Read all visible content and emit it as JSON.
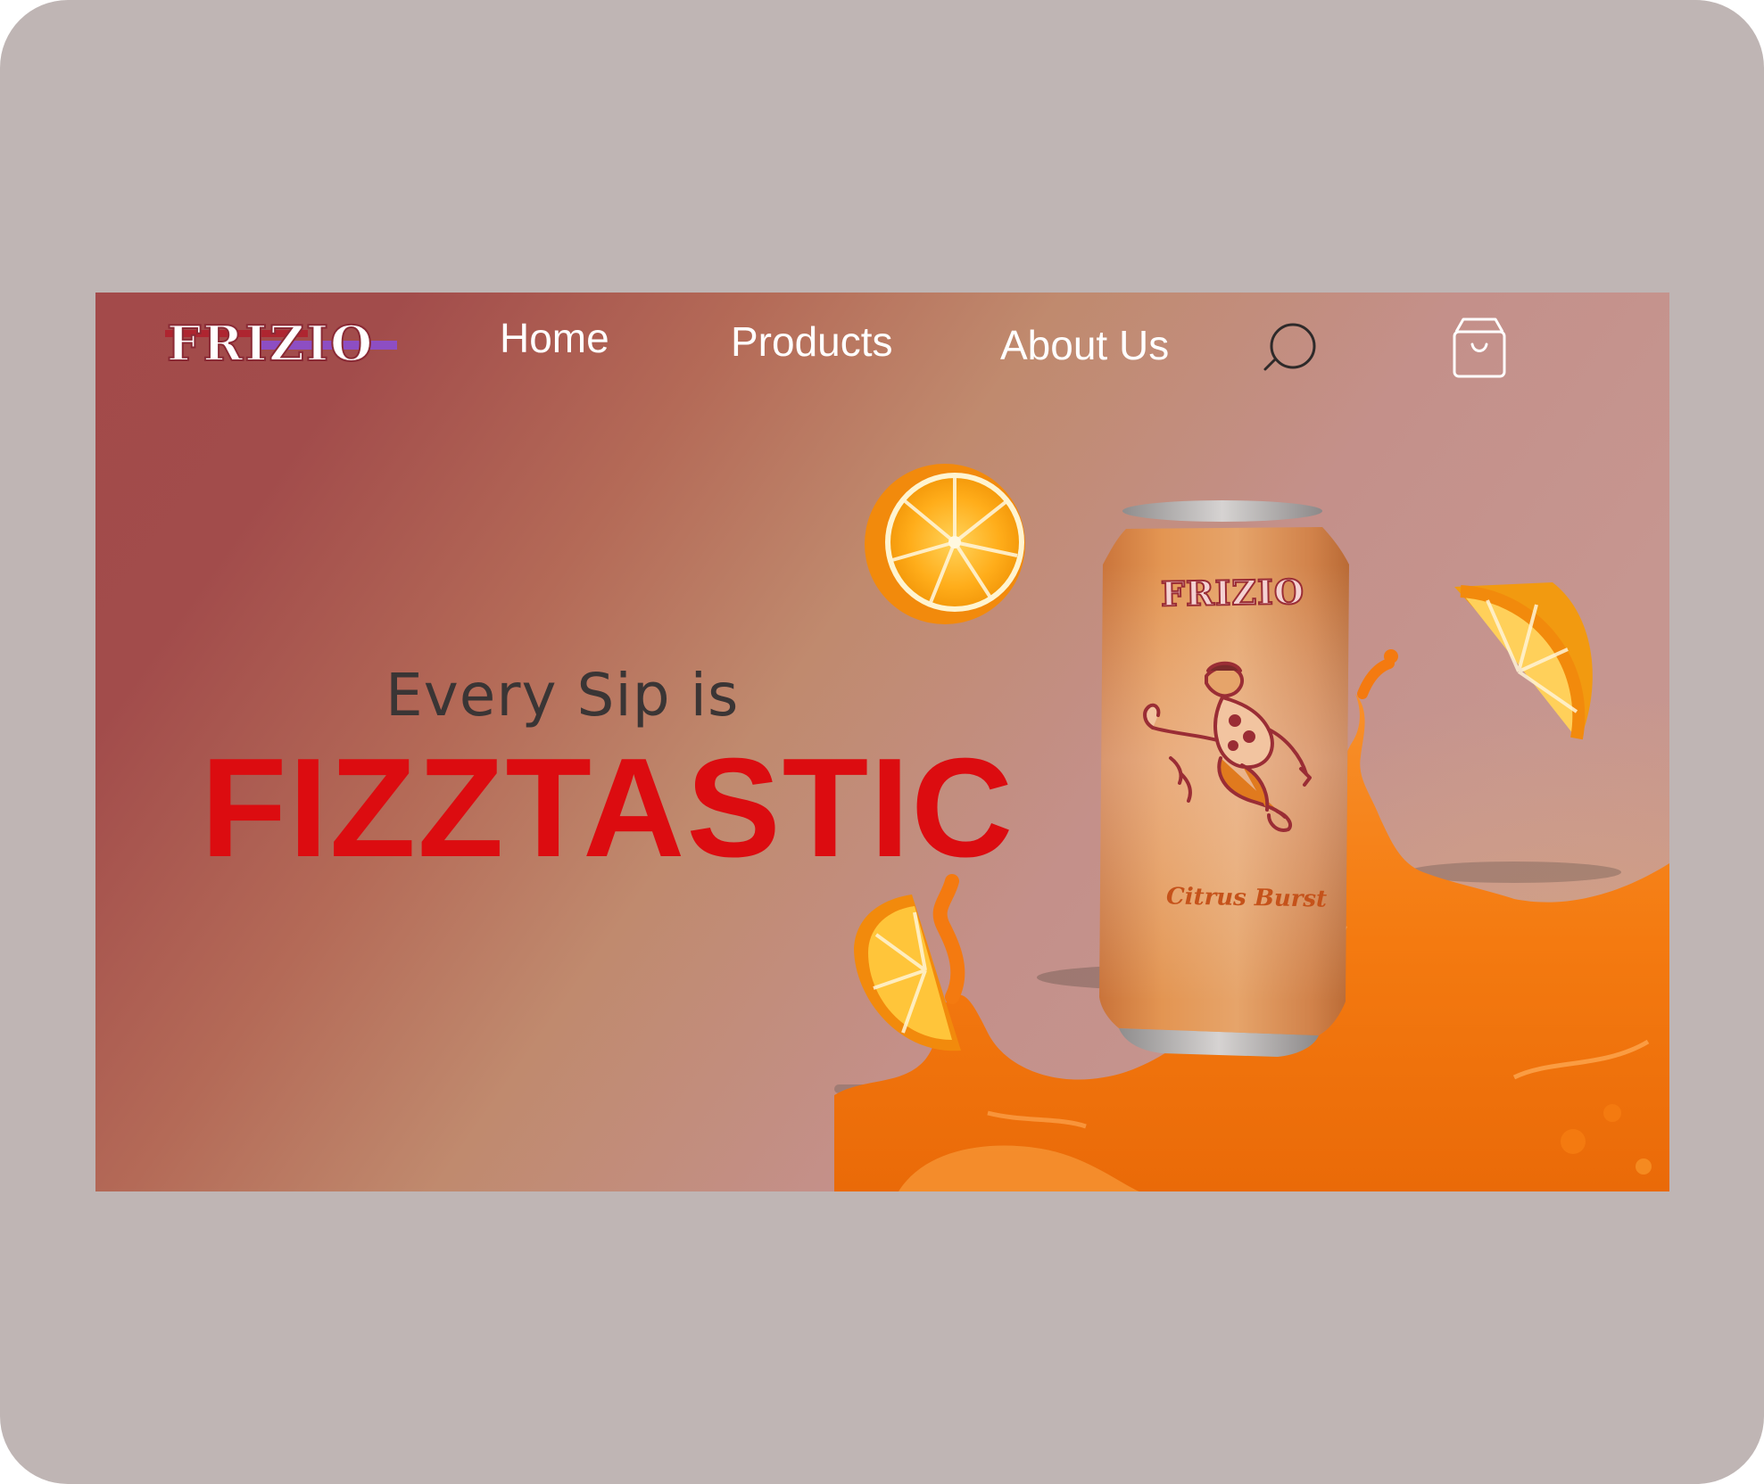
{
  "brand": {
    "logo_text": "FRIZIO"
  },
  "nav": {
    "items": [
      {
        "label": "Home"
      },
      {
        "label": "Products"
      },
      {
        "label": "About Us"
      }
    ],
    "search_icon": "search-icon",
    "cart_icon": "shopping-bag-icon"
  },
  "hero": {
    "tagline": "Every Sip is",
    "headline": "FIZZTASTIC",
    "product": {
      "can_logo": "FRIZIO",
      "flavor": "Citrus Burst"
    }
  },
  "colors": {
    "frame_background": "#bfb5b4",
    "headline_red": "#dc0c10",
    "tagline_dark": "#3a3535",
    "nav_text": "#ffffff",
    "juice_orange": "#f47a10",
    "can_orange": "#d8883e"
  }
}
